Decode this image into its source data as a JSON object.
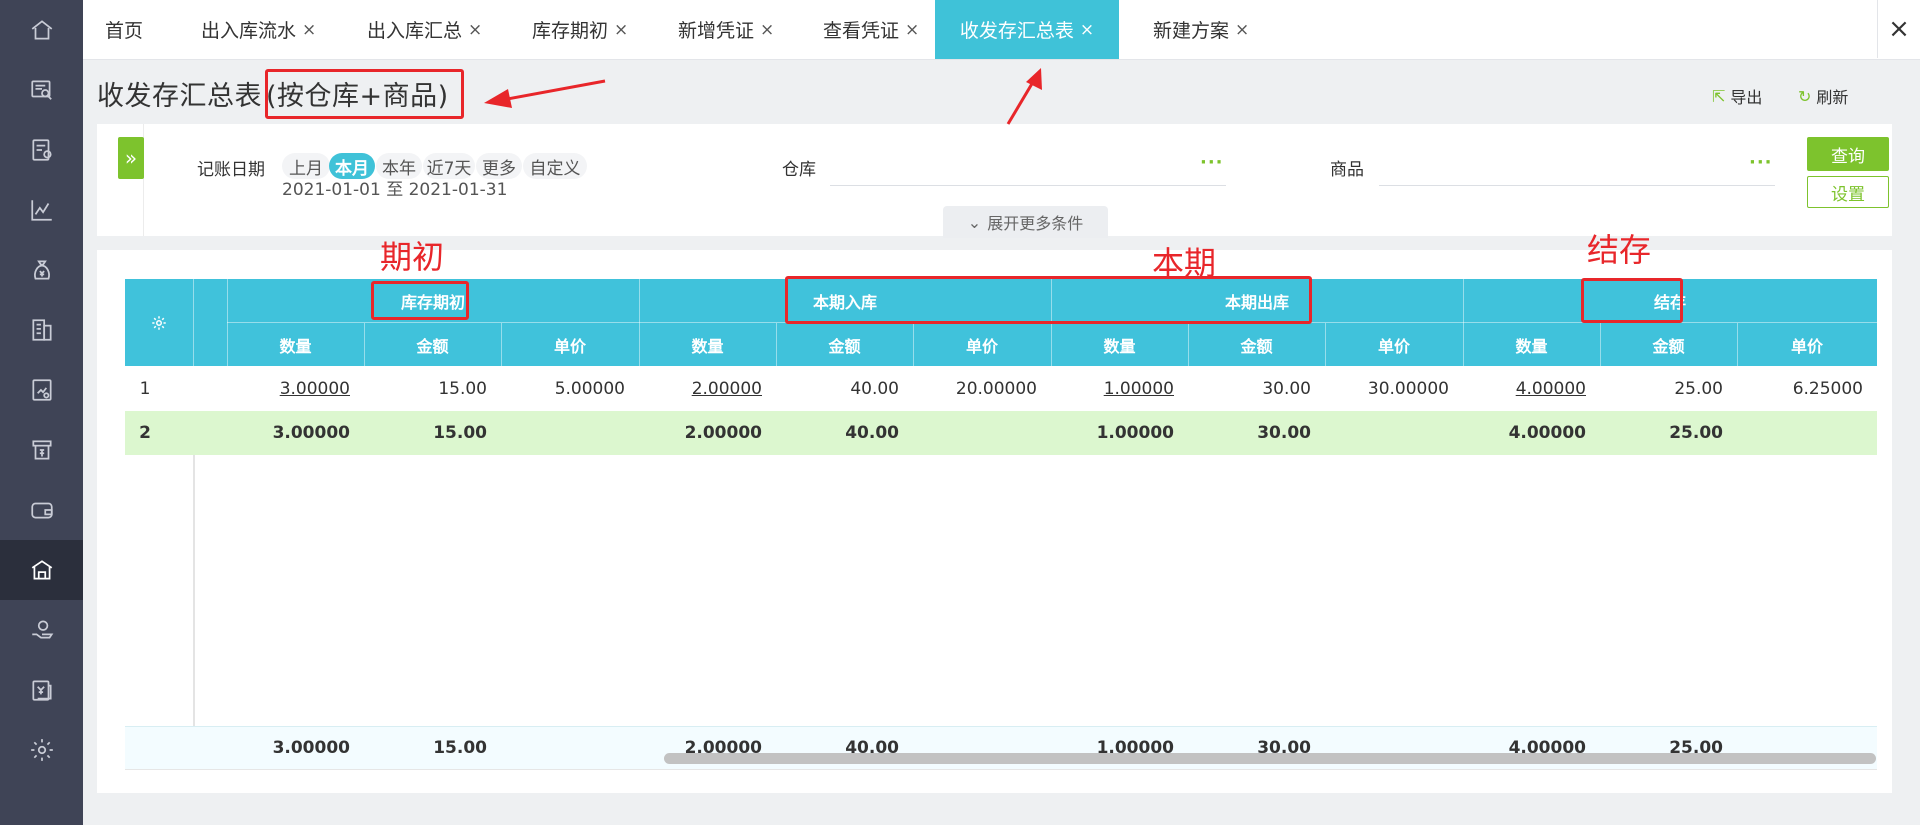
{
  "sidebar": {
    "icons": [
      "home-icon",
      "search-doc-icon",
      "voucher-icon",
      "chart-icon",
      "money-bag-icon",
      "ledger-icon",
      "report-icon",
      "asset-icon",
      "wallet-icon",
      "warehouse-icon",
      "hand-coin-icon",
      "invoice-icon",
      "gear-icon"
    ],
    "active_index": 9
  },
  "tabs": [
    {
      "label": "首页",
      "closable": false
    },
    {
      "label": "出入库流水",
      "closable": true
    },
    {
      "label": "出入库汇总",
      "closable": true
    },
    {
      "label": "库存期初",
      "closable": true
    },
    {
      "label": "新增凭证",
      "closable": true
    },
    {
      "label": "查看凭证",
      "closable": true
    },
    {
      "label": "收发存汇总表",
      "closable": true,
      "active": true
    },
    {
      "label": "新建方案",
      "closable": true
    }
  ],
  "close_glyph": "×",
  "page": {
    "title": "收发存汇总表",
    "subtitle": "(按仓库+商品)",
    "export_label": "导出",
    "refresh_label": "刷新"
  },
  "filter": {
    "date_label": "记账日期",
    "date_chips": [
      "上月",
      "本月",
      "本年",
      "近7天",
      "更多",
      "自定义"
    ],
    "date_active": "本月",
    "date_range": "2021-01-01 至 2021-01-31",
    "warehouse_label": "仓库",
    "warehouse_value": "",
    "product_label": "商品",
    "product_value": "",
    "dots": "···",
    "query_label": "查询",
    "settings_label": "设置",
    "more_label": "展开更多条件"
  },
  "table": {
    "groups": [
      "库存期初",
      "本期入库",
      "本期出库",
      "结存"
    ],
    "sub_columns": [
      "数量",
      "金额",
      "单价"
    ],
    "rows": [
      {
        "no": "1",
        "cells": [
          "3.00000",
          "15.00",
          "5.00000",
          "2.00000",
          "40.00",
          "20.00000",
          "1.00000",
          "30.00",
          "30.00000",
          "4.00000",
          "25.00",
          "6.25000"
        ]
      },
      {
        "no": "2",
        "cells": [
          "3.00000",
          "15.00",
          "",
          "2.00000",
          "40.00",
          "",
          "1.00000",
          "30.00",
          "",
          "4.00000",
          "25.00",
          ""
        ]
      }
    ],
    "footer": [
      "3.00000",
      "15.00",
      "",
      "2.00000",
      "40.00",
      "",
      "1.00000",
      "30.00",
      "",
      "4.00000",
      "25.00",
      ""
    ]
  },
  "annotations": {
    "opening": "期初",
    "current": "本期",
    "closing": "结存"
  },
  "colors": {
    "accent_cyan": "#40c2db",
    "accent_green": "#7dc32d",
    "annotation_red": "#e8262a",
    "sidebar_bg": "#3f4456"
  }
}
